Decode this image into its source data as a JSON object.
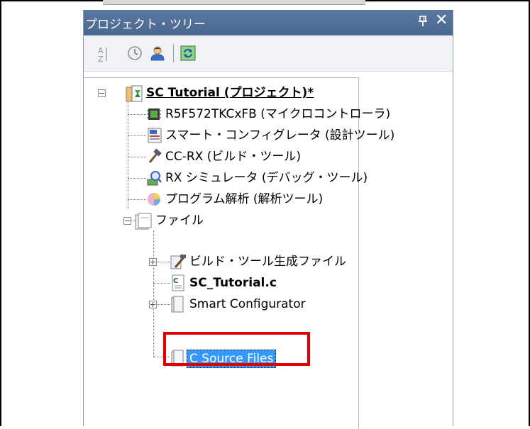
{
  "panel": {
    "title": "プロジェクト・ツリー",
    "pin_icon": "pin-icon",
    "close_glyph": "✕"
  },
  "toolbar": {
    "buttons": [
      {
        "name": "sort-az-icon"
      },
      {
        "name": "history-icon"
      },
      {
        "name": "user-icon"
      },
      {
        "name": "refresh-icon"
      }
    ]
  },
  "tree": {
    "project": "SC Tutorial (プロジェクト)*",
    "mcu": "R5F572TKCxFB (マイクロコントローラ)",
    "smart_config_tool": "スマート・コンフィグレータ (設計ツール)",
    "build_tool": "CC-RX (ビルド・ツール)",
    "debug_tool": "RX シミュレータ (デバッグ・ツール)",
    "analysis_tool": "プログラム解析 (解析ツール)",
    "files": "ファイル",
    "build_generated": "ビルド・ツール生成ファイル",
    "main_c": "SC_Tutorial.c",
    "smart_configurator_folder": "Smart Configurator",
    "c_source_files": "C Source Files"
  },
  "colors": {
    "titlebar": "#4f6d94",
    "selection": "#3399ff",
    "highlight_box": "#e00000"
  }
}
